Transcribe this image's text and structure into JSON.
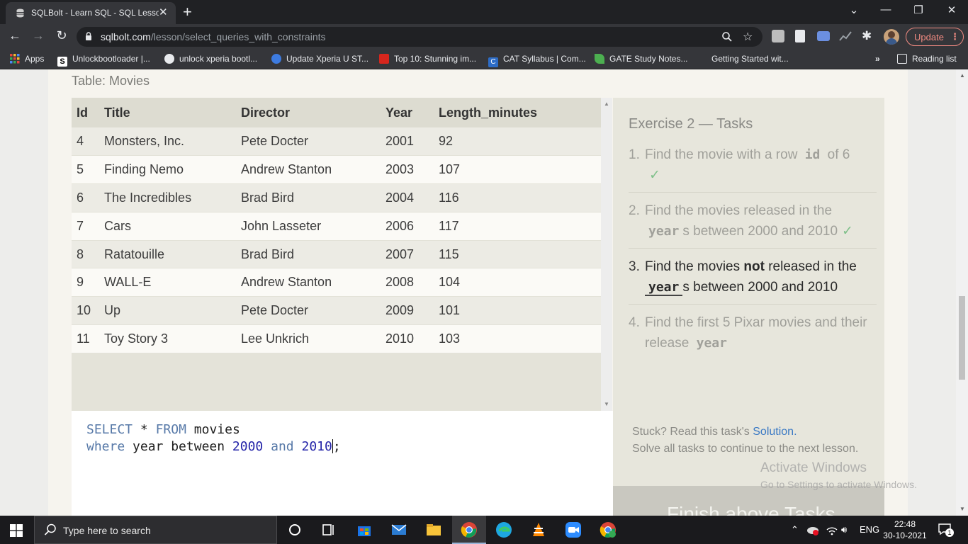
{
  "browser": {
    "tab_title": "SQLBolt - Learn SQL - SQL Lesson",
    "url_host": "sqlbolt.com",
    "url_path": "/lesson/select_queries_with_constraints",
    "update_label": "Update",
    "bookmarks": [
      {
        "label": "Apps",
        "color": "#e8453c"
      },
      {
        "label": "Unlockbootloader |...",
        "color": "#ffffff"
      },
      {
        "label": "unlock xperia bootl...",
        "color": "#e8eaed"
      },
      {
        "label": "Update Xperia U ST...",
        "color": "#3d7be0"
      },
      {
        "label": "Top 10: Stunning im...",
        "color": "#d6261d"
      },
      {
        "label": "CAT Syllabus | Com...",
        "color": "#2d6cc6"
      },
      {
        "label": "GATE Study Notes...",
        "color": "#4caf50"
      },
      {
        "label": "Getting Started wit...",
        "color": "#35363a"
      }
    ],
    "reading_list": "Reading list"
  },
  "lesson": {
    "table_caption": "Table: Movies",
    "columns": [
      "Id",
      "Title",
      "Director",
      "Year",
      "Length_minutes"
    ],
    "rows": [
      [
        "4",
        "Monsters, Inc.",
        "Pete Docter",
        "2001",
        "92"
      ],
      [
        "5",
        "Finding Nemo",
        "Andrew Stanton",
        "2003",
        "107"
      ],
      [
        "6",
        "The Incredibles",
        "Brad Bird",
        "2004",
        "116"
      ],
      [
        "7",
        "Cars",
        "John Lasseter",
        "2006",
        "117"
      ],
      [
        "8",
        "Ratatouille",
        "Brad Bird",
        "2007",
        "115"
      ],
      [
        "9",
        "WALL-E",
        "Andrew Stanton",
        "2008",
        "104"
      ],
      [
        "10",
        "Up",
        "Pete Docter",
        "2009",
        "101"
      ],
      [
        "11",
        "Toy Story 3",
        "Lee Unkrich",
        "2010",
        "103"
      ]
    ],
    "query": {
      "l1_kw1": "SELECT",
      "l1_star": "*",
      "l1_kw2": "FROM",
      "l1_table": "movies",
      "l2_kw1": "where",
      "l2_mid": "year between",
      "l2_n1": "2000",
      "l2_kw2": "and",
      "l2_n2": "2010",
      "l2_end": ";"
    },
    "exercise_title": "Exercise 2 — Tasks",
    "tasks": [
      {
        "idx": "1.",
        "pre": "Find the movie with a row",
        "code": "id",
        "post": "of 6",
        "check": "✓"
      },
      {
        "idx": "2.",
        "pre": "Find the movies released in the",
        "code": "year",
        "post": "s between 2000 and 2010",
        "check": "✓"
      },
      {
        "idx": "3.",
        "pre": "Find the movies",
        "bold": "not",
        "pre2": "released in the",
        "code": "year",
        "post": "s between 2000 and 2010"
      },
      {
        "idx": "4.",
        "pre": "Find the first 5 Pixar movies and their release",
        "code": "year"
      }
    ],
    "stuck_pre": "Stuck? Read this task's",
    "stuck_link": "Solution.",
    "stuck_post": "Solve all tasks to continue to the next lesson.",
    "finish_label": "Finish above Tasks"
  },
  "watermark": {
    "line1": "Activate Windows",
    "line2": "Go to Settings to activate Windows."
  },
  "taskbar": {
    "search_placeholder": "Type here to search",
    "lang": "ENG",
    "time": "22:48",
    "date": "30-10-2021",
    "notif_count": "1"
  }
}
